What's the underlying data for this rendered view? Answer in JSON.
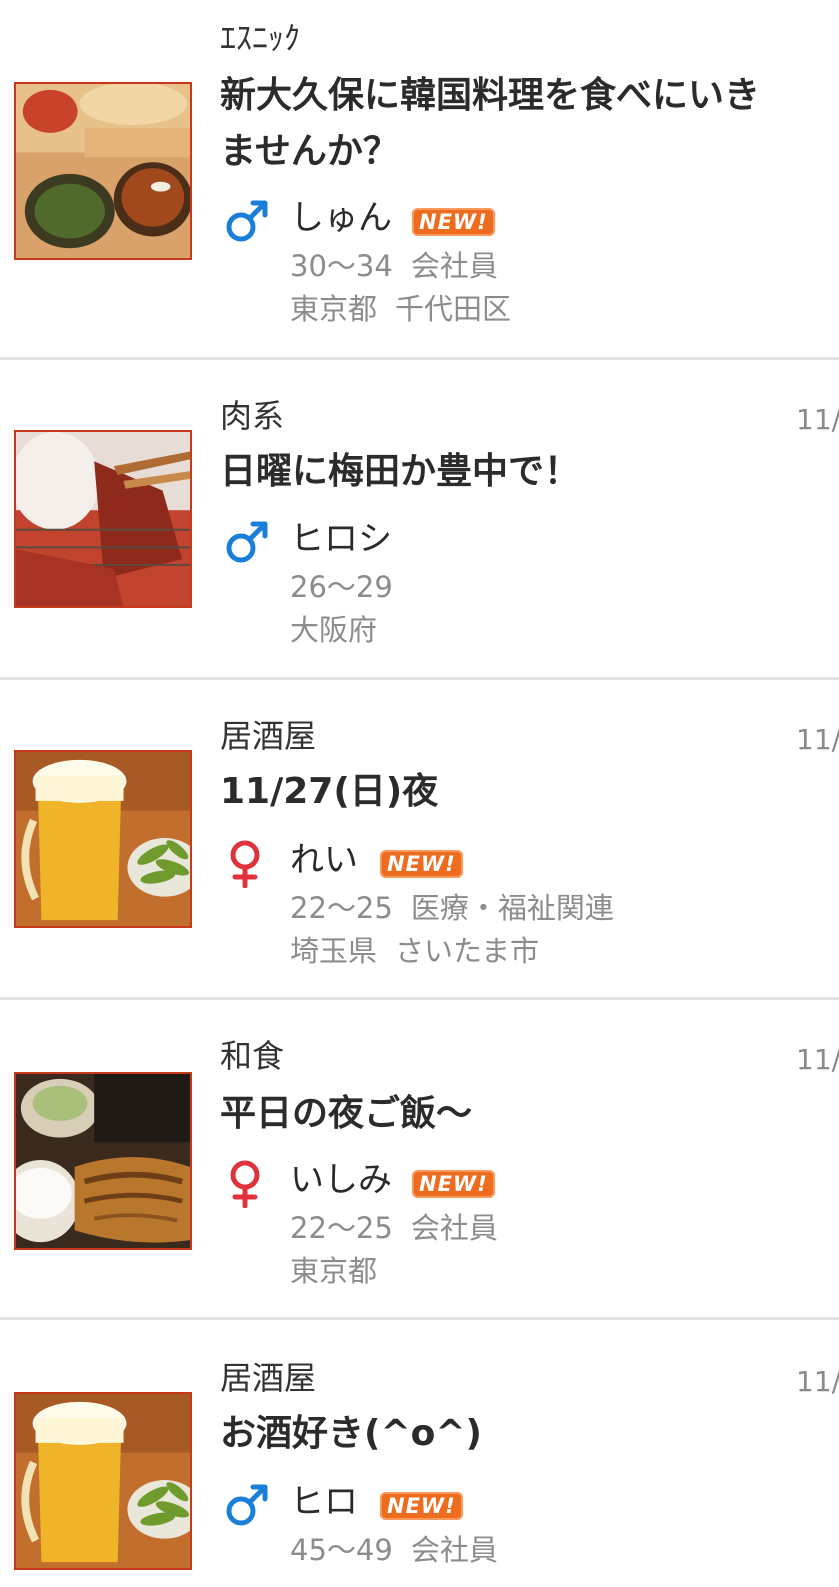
{
  "colors": {
    "male": "#1a7fd8",
    "female": "#e0323c",
    "new_badge": "#ee6c1e",
    "thumb_border": "#c8391b",
    "divider": "#e3e3e3"
  },
  "posts": [
    {
      "category": "ｴｽﾆｯｸ",
      "date": "",
      "title": "新大久保に韓国料理を食べにいきませんか？",
      "gender": "male",
      "gender_icon": "male-symbol-icon",
      "name": "しゅん",
      "new_badge": "NEW!",
      "age": "30〜34",
      "job": "会社員",
      "prefecture": "東京都",
      "city": "千代田区",
      "thumb": "curry-plate"
    },
    {
      "category": "肉系",
      "date": "11/",
      "title": "日曜に梅田か豊中で！",
      "gender": "male",
      "gender_icon": "male-symbol-icon",
      "name": "ヒロシ",
      "new_badge": "",
      "age": "26〜29",
      "job": "",
      "prefecture": "大阪府",
      "city": "",
      "thumb": "grilled-meat"
    },
    {
      "category": "居酒屋",
      "date": "11/",
      "title": "11/27(日)夜",
      "gender": "female",
      "gender_icon": "female-symbol-icon",
      "name": "れい",
      "new_badge": "NEW!",
      "age": "22〜25",
      "job": "医療・福祉関連",
      "prefecture": "埼玉県",
      "city": "さいたま市",
      "thumb": "beer-edamame"
    },
    {
      "category": "和食",
      "date": "11/",
      "title": "平日の夜ご飯〜",
      "gender": "female",
      "gender_icon": "female-symbol-icon",
      "name": "いしみ",
      "new_badge": "NEW!",
      "age": "22〜25",
      "job": "会社員",
      "prefecture": "東京都",
      "city": "",
      "thumb": "grilled-fish-set"
    },
    {
      "category": "居酒屋",
      "date": "11/",
      "title": "お酒好き(^o^)",
      "gender": "male",
      "gender_icon": "male-symbol-icon",
      "name": "ヒロ",
      "new_badge": "NEW!",
      "age": "45〜49",
      "job": "会社員",
      "prefecture": "",
      "city": "",
      "thumb": "beer-edamame"
    }
  ]
}
